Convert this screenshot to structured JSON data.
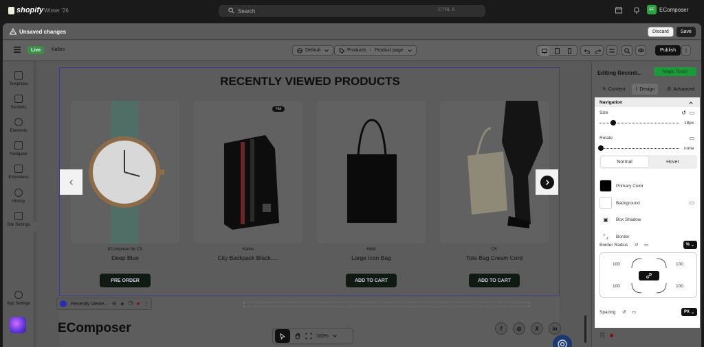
{
  "topbar": {
    "brand": "shopify",
    "store": "Winter '26",
    "search_placeholder": "Search",
    "search_shortcut": "CTRL K",
    "user_initials": "EC",
    "user_name": "EComposer"
  },
  "unsaved": {
    "message": "Unsaved changes",
    "discard": "Discard",
    "save": "Save"
  },
  "header": {
    "status": "Live",
    "theme": "Kalles",
    "device_selector": "Default",
    "breadcrumb_products": "Products",
    "breadcrumb_page": "Product page",
    "publish": "Publish"
  },
  "sidebar": {
    "items": [
      {
        "label": "Templates"
      },
      {
        "label": "Sections"
      },
      {
        "label": "Elements"
      },
      {
        "label": "Navigator"
      },
      {
        "label": "Extensions"
      },
      {
        "label": "History"
      },
      {
        "label": "Site Settings"
      }
    ],
    "app_settings": "App Settings"
  },
  "canvas": {
    "heading": "RECENTLY VIEWED PRODUCTS",
    "products": [
      {
        "vendor": "EComposer for CS",
        "title": "Deep Blue",
        "button": "PRE ORDER",
        "badge": ""
      },
      {
        "vendor": "Kalles",
        "title": "City Backpack Black.....",
        "button": "",
        "badge": "Hot"
      },
      {
        "vendor": "H&M",
        "title": "Large Icon Bag",
        "button": "ADD TO CART",
        "badge": ""
      },
      {
        "vendor": "CK",
        "title": "Tote Bag Cream Cord",
        "button": "ADD TO CART",
        "badge": ""
      }
    ],
    "section_toolbar_label": "Recently Viewe...",
    "footer_logo": "EComposer",
    "social": [
      "f",
      "◎",
      "X",
      "in"
    ],
    "zoom": "100%"
  },
  "panel": {
    "title": "Editing Recenti...",
    "magic": "Magic Touch",
    "tabs": {
      "content": "Content",
      "design": "Design",
      "advanced": "Advanced"
    },
    "navigation": "Navigation",
    "size_label": "Size",
    "size_value": "18px",
    "size_fraction": 0.17,
    "rotate_label": "Rotate",
    "rotate_value": "none",
    "state_normal": "Normal",
    "state_hover": "Hover",
    "primary_color_label": "Primary Color",
    "primary_color": "#000000",
    "background_label": "Background",
    "box_shadow_label": "Box Shadow",
    "border_label": "Border",
    "border_radius_label": "Border Radius",
    "border_radius_unit": "%",
    "radius": {
      "tl": "100",
      "tr": "100",
      "bl": "100",
      "br": "100"
    },
    "spacing_label": "Spacing",
    "spacing_unit": "PX"
  }
}
